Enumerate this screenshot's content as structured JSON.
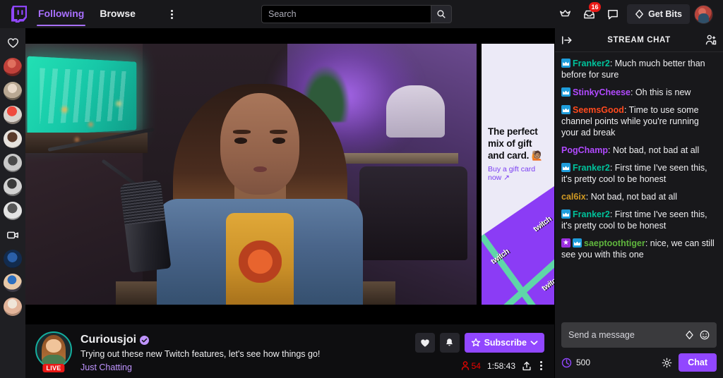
{
  "nav": {
    "logo_icon": "twitch-logo-icon",
    "links": [
      {
        "label": "Following",
        "active": true
      },
      {
        "label": "Browse",
        "active": false
      }
    ],
    "more_icon": "kebab-menu-icon"
  },
  "search": {
    "value": "",
    "placeholder": "Search",
    "search_icon": "search-icon"
  },
  "topnav_right": {
    "prime_icon": "crown-icon",
    "inbox_icon": "inbox-icon",
    "inbox_badge": "16",
    "whispers_icon": "chat-bubble-icon",
    "bits_label": "Get Bits",
    "bits_icon": "bits-diamond-icon",
    "avatar_icon": "user-avatar"
  },
  "rail": {
    "top_icon": "heart-icon",
    "video_icon": "video-camera-icon",
    "avatars": [
      {
        "name": "followed-channel-1"
      },
      {
        "name": "followed-channel-2"
      },
      {
        "name": "followed-channel-3"
      },
      {
        "name": "followed-channel-4"
      },
      {
        "name": "followed-channel-5"
      },
      {
        "name": "followed-channel-6"
      },
      {
        "name": "followed-channel-7"
      },
      {
        "name": "followed-channel-8"
      },
      {
        "name": "followed-channel-9"
      },
      {
        "name": "followed-channel-10"
      }
    ]
  },
  "ad": {
    "headline": "The perfect mix of gift and card.",
    "emoji": "🙋🏽",
    "link": "Buy a gift card now ↗",
    "brand_mark": "twitch",
    "bg_color": "#eceaf7",
    "accent_color": "#8b3cf5",
    "ribbon_color": "#5fd6a8"
  },
  "channel": {
    "name": "Curiousjoi",
    "verified_icon": "verified-badge-icon",
    "live_badge": "LIVE",
    "title": "Trying out these new Twitch features, let's see how things go!",
    "category": "Just Chatting",
    "viewers": "54",
    "viewer_icon": "viewer-count-icon",
    "uptime": "1:58:43",
    "share_icon": "share-icon",
    "more_icon": "more-options-icon",
    "heart_icon": "heart-icon",
    "bell_icon": "bell-icon",
    "subscribe_label": "Subscribe",
    "subscribe_star_icon": "star-icon",
    "subscribe_chevron_icon": "chevron-down-icon"
  },
  "chat": {
    "collapse_icon": "collapse-right-icon",
    "title": "STREAM CHAT",
    "community_icon": "community-users-icon",
    "messages": [
      {
        "badges": [
          "sub"
        ],
        "user": "Franker2",
        "color": "#00c29b",
        "text": ": Much much better than before for sure"
      },
      {
        "badges": [
          "sub"
        ],
        "user": "StinkyCheese",
        "color": "#b14aff",
        "text": ": Oh this is new"
      },
      {
        "badges": [
          "sub"
        ],
        "user": "SeemsGood",
        "color": "#ff4a1e",
        "text": ": Time to use some channel points while you're running your ad break"
      },
      {
        "badges": [],
        "user": "PogChamp",
        "color": "#b14aff",
        "text": ": Not bad, not bad at all"
      },
      {
        "badges": [
          "sub"
        ],
        "user": "Franker2",
        "color": "#00c29b",
        "text": ": First time I've seen this, it's pretty cool to be honest"
      },
      {
        "badges": [],
        "user": "cal6ix",
        "color": "#d19a23",
        "text": ": Not bad, not bad at all"
      },
      {
        "badges": [
          "sub"
        ],
        "user": "Franker2",
        "color": "#00c29b",
        "text": ": First time I've seen this, it's pretty cool to be honest"
      },
      {
        "badges": [
          "vip",
          "sub"
        ],
        "user": "saeptoothtiger",
        "color": "#5fb53d",
        "text": ": nice, we can still see you with this one"
      }
    ],
    "input_value": "",
    "input_placeholder": "Send a message",
    "bits_icon": "bits-diamond-icon",
    "emote_icon": "emote-smiley-icon",
    "points_value": "500",
    "points_icon": "channel-points-icon",
    "settings_icon": "gear-icon",
    "send_label": "Chat"
  },
  "colors": {
    "brand_purple": "#9147ff",
    "accent_purple": "#a970ff",
    "live_red": "#e91916",
    "bg": "#0e0e10",
    "panel": "#18181b",
    "rail": "#1f1f23"
  }
}
